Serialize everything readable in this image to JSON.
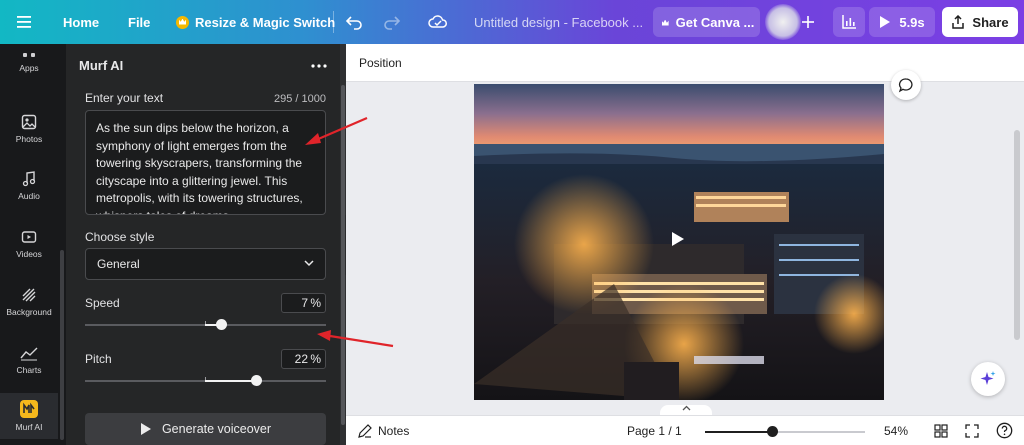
{
  "topbar": {
    "home_label": "Home",
    "file_label": "File",
    "resize_label": "Resize & Magic Switch",
    "design_title": "Untitled design - Facebook ...",
    "get_canva_label": "Get Canva ...",
    "present_time": "5.9s",
    "share_label": "Share",
    "icons": [
      "menu-icon",
      "crown-icon",
      "undo-icon",
      "redo-icon",
      "cloud-sync-icon",
      "plus-icon",
      "analytics-icon",
      "play-icon",
      "share-icon"
    ]
  },
  "rail": {
    "items": [
      {
        "label": "Apps",
        "icon": "apps-icon"
      },
      {
        "label": "Photos",
        "icon": "photos-icon"
      },
      {
        "label": "Audio",
        "icon": "audio-icon"
      },
      {
        "label": "Videos",
        "icon": "videos-icon"
      },
      {
        "label": "Background",
        "icon": "background-icon"
      },
      {
        "label": "Charts",
        "icon": "charts-icon"
      },
      {
        "label": "Murf AI",
        "icon": "murf-ai-icon",
        "active": true
      }
    ]
  },
  "panel": {
    "title": "Murf AI",
    "text_label": "Enter your text",
    "char_count": "295 / 1000",
    "text_value": "As the sun dips below the horizon, a symphony of light emerges from the towering skyscrapers, transforming the cityscape into a glittering jewel. This metropolis, with its towering structures, whispers tales of dreams",
    "style_label": "Choose style",
    "style_value": "General",
    "speed_label": "Speed",
    "speed_value": "7",
    "speed_unit": "%",
    "speed_fraction": 0.565,
    "pitch_label": "Pitch",
    "pitch_value": "22",
    "pitch_unit": "%",
    "pitch_fraction": 0.71,
    "generate_label": "Generate voiceover"
  },
  "canvas": {
    "context_label": "Position"
  },
  "bottombar": {
    "notes_label": "Notes",
    "page_label": "Page 1 / 1",
    "zoom_value": "54%",
    "zoom_fraction": 0.42
  },
  "colors": {
    "annotation": "#e0242a",
    "panel_bg": "#252627",
    "rail_bg": "#18191b"
  }
}
